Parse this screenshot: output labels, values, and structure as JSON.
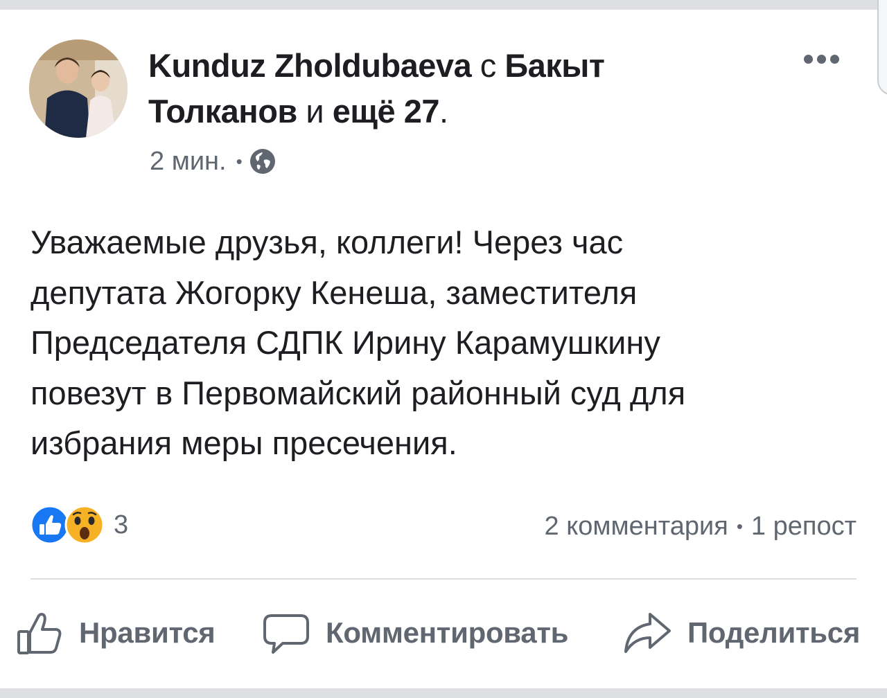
{
  "post": {
    "author": "Kunduz Zholdubaeva",
    "conjunction": "с",
    "tagged": "Бакыт Толканов",
    "and_more": "и",
    "others": "ещё 27",
    "period": ".",
    "timestamp": "2 мин.",
    "separator": "•",
    "audience_icon": "globe-icon",
    "text": "Уважаемые друзья, коллеги! Через час\nдепутата Жогорку Кенеша, заместителя\nПредседателя СДПК Ирину Карамушкину\nповезут в Первомайский районный суд для\nизбрания меры пресечения."
  },
  "reactions": {
    "icons": [
      "like-reaction-icon",
      "wow-reaction-icon"
    ],
    "count": "3"
  },
  "stats": {
    "comments": "2 комментария",
    "separator": "•",
    "shares": "1 репост"
  },
  "actions": {
    "like": "Нравится",
    "comment": "Комментировать",
    "share": "Поделиться"
  },
  "colors": {
    "text": "#1c1e21",
    "secondary": "#606770",
    "like_blue": "#1877f2",
    "wow_yellow": "#f7b125",
    "divider": "#dadde1"
  }
}
